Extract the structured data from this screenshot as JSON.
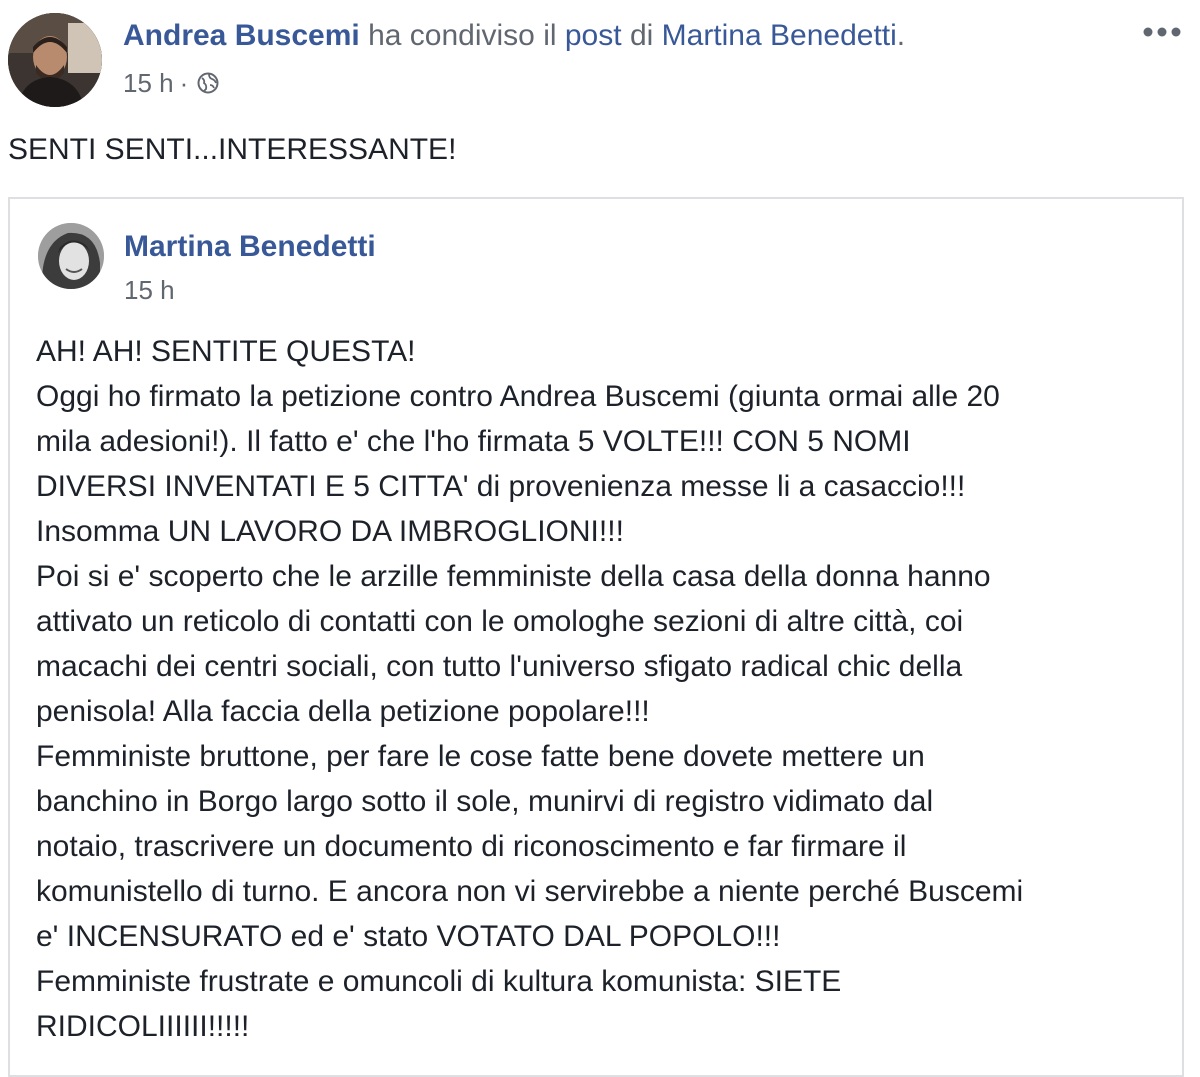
{
  "post": {
    "author": "Andrea Buscemi",
    "action": "ha condiviso il",
    "object_link": "post",
    "preposition": "di",
    "original_author_link": "Martina Benedetti",
    "trailing": ".",
    "timestamp": "15 h",
    "separator": "·",
    "privacy_icon": "globe-icon",
    "more_icon": "more-options-icon",
    "text": "SENTI SENTI...INTERESSANTE!"
  },
  "shared_post": {
    "author": "Martina Benedetti",
    "timestamp": "15 h",
    "lines": [
      "AH! AH! SENTITE QUESTA!",
      "Oggi ho firmato la petizione contro Andrea Buscemi (giunta ormai alle 20",
      "mila adesioni!). Il fatto e' che l'ho firmata 5 VOLTE!!! CON 5 NOMI",
      "DIVERSI INVENTATI E 5 CITTA' di provenienza messe li a casaccio!!!",
      "Insomma UN LAVORO DA IMBROGLIONI!!!",
      "Poi si e' scoperto che le arzille femministe della casa della donna hanno",
      "attivato un reticolo di contatti con le omologhe sezioni di altre città, coi",
      "macachi dei centri sociali, con tutto l'universo sfigato radical chic della",
      "penisola! Alla faccia della petizione popolare!!!",
      "Femministe bruttone, per fare le cose fatte bene dovete mettere un",
      "banchino in Borgo largo sotto il sole, munirvi di registro vidimato dal",
      "notaio, trascrivere un documento di riconoscimento e far firmare il",
      "komunistello di turno. E ancora non vi servirebbe a niente perché Buscemi",
      "e' INCENSURATO ed e' stato VOTATO DAL POPOLO!!!",
      "Femministe frustrate e omuncoli di kultura komunista: SIETE",
      "RIDICOLIIIIII!!!!!"
    ]
  },
  "colors": {
    "link": "#385898",
    "meta": "#616770",
    "text": "#1d2129",
    "border": "#dddfe2"
  }
}
